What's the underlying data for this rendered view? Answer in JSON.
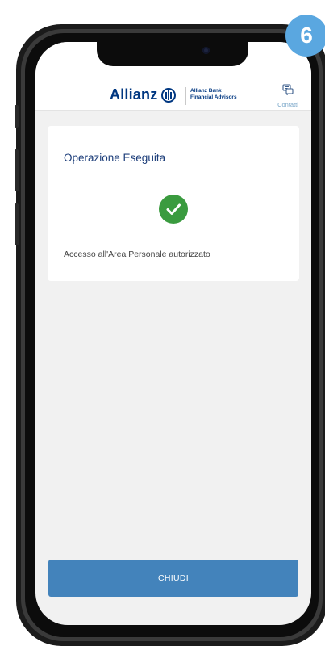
{
  "step_badge": "6",
  "header": {
    "brand": "Allianz",
    "sub_brand_line1": "Allianz Bank",
    "sub_brand_line2": "Financial Advisors",
    "contacts_label": "Contatti"
  },
  "card": {
    "title": "Operazione Eseguita",
    "message": "Accesso all'Area Personale autorizzato"
  },
  "footer": {
    "close_label": "CHIUDI"
  },
  "colors": {
    "brand_blue": "#003781",
    "button_blue": "#4383bb",
    "success_green": "#3a9b3f",
    "badge_blue": "#5aa7e0"
  },
  "icons": [
    "allianz-logo-icon",
    "contacts-chat-icon",
    "check-icon"
  ]
}
